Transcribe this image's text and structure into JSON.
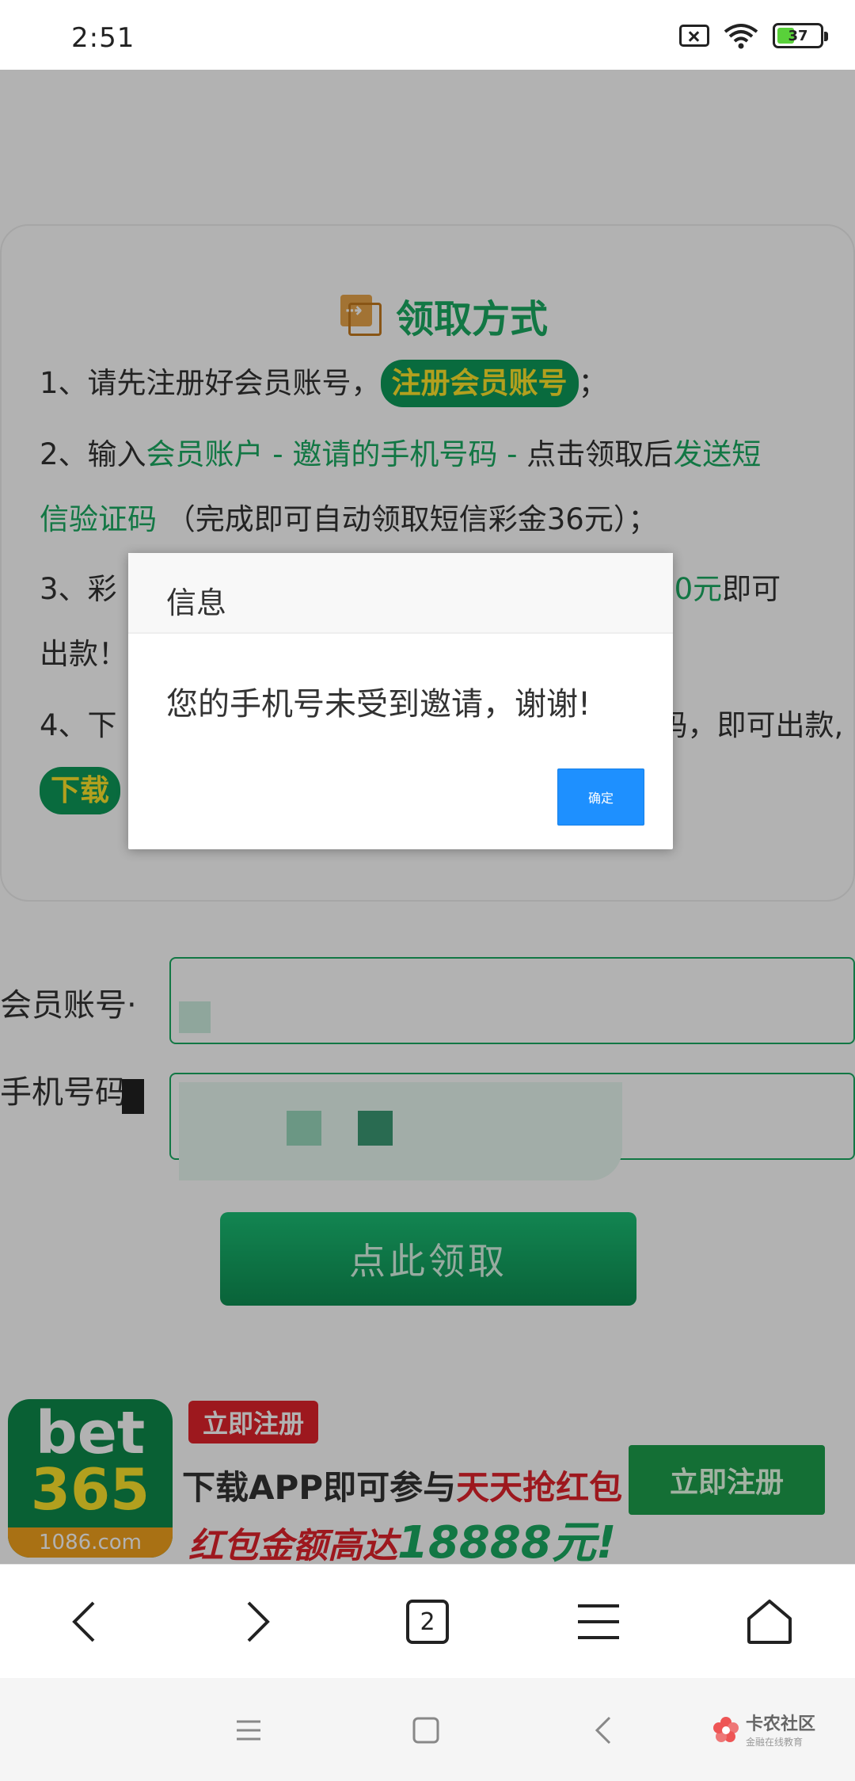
{
  "status_bar": {
    "time": "2:51",
    "battery_level": "37"
  },
  "card": {
    "title": "领取方式",
    "step1": {
      "prefix": "1、请先注册好会员账号，",
      "pill": "注册会员账号",
      "suffix": "；"
    },
    "step2": {
      "prefix": "2、输入",
      "green1": "会员账户 - 邀请的手机号码 -",
      "mid": " 点击领取后",
      "green2": "发送短",
      "line2_green": "信验证码",
      "line2_rest": " （完成即可自动领取短信彩金36元）；"
    },
    "step3": {
      "prefix": "3、彩",
      "green": "满200元",
      "suffix": "即可",
      "line2": "出款！"
    },
    "step4": {
      "prefix": "4、下",
      "suffix": "码，即可出款,",
      "pill": "下载"
    }
  },
  "form": {
    "account_label": "会员账号·",
    "phone_label": "手机号码",
    "submit": "点此领取"
  },
  "banner": {
    "logo_line1": "bet",
    "logo_line2": "365",
    "logo_domain": "1086.com",
    "tag": "立即注册",
    "promo_line1_a": "下载APP即可参与",
    "promo_line1_b": "天天抢红包",
    "promo_line2_a": "红包金额高达",
    "promo_line2_amount": "18888元!",
    "button": "立即注册"
  },
  "dialog": {
    "title": "信息",
    "message": "您的手机号未受到邀请，谢谢!",
    "ok": "确定"
  },
  "browser_nav": {
    "tab_count": "2"
  },
  "watermark": {
    "name": "卡农社区",
    "sub": "金融在线教育"
  },
  "colors": {
    "accent_green": "#1aab62",
    "dialog_button": "#1e90ff",
    "promo_red": "#e1232b"
  }
}
